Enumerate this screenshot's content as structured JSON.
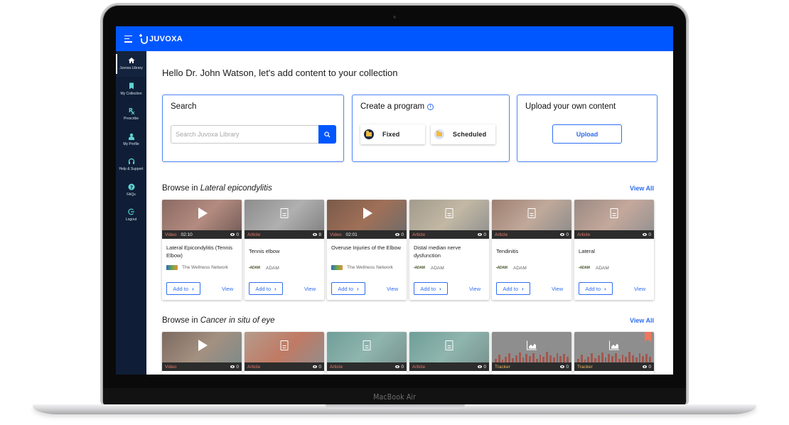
{
  "device": {
    "label": "MacBook Air"
  },
  "topbar": {
    "brand": "JUVOXA",
    "menu_icon": "hamburger-menu-icon",
    "primary_color": "#0057ff"
  },
  "sidebar": {
    "bg_color": "#0f1e36",
    "items": [
      {
        "label": "Juvoxa Library",
        "icon": "home-icon",
        "active": true
      },
      {
        "label": "My Collection",
        "icon": "bookmark-icon",
        "active": false
      },
      {
        "label": "Prescribe",
        "icon": "rx-icon",
        "active": false
      },
      {
        "label": "My Profile",
        "icon": "user-icon",
        "active": false
      },
      {
        "label": "Help & Support",
        "icon": "headset-icon",
        "active": false
      },
      {
        "label": "FAQs",
        "icon": "question-icon",
        "active": false
      },
      {
        "label": "Logout",
        "icon": "logout-icon",
        "active": false
      }
    ]
  },
  "main": {
    "greeting": "Hello Dr. John Watson, let's add content to your collection",
    "search": {
      "title": "Search",
      "placeholder": "Search Juvoxa Library",
      "value": ""
    },
    "program": {
      "title": "Create a program",
      "options": [
        {
          "label": "Fixed"
        },
        {
          "label": "Scheduled"
        }
      ]
    },
    "upload": {
      "title": "Upload your own content",
      "button": "Upload"
    },
    "sections": [
      {
        "prefix": "Browse in ",
        "topic": "Lateral epicondylitis",
        "view_all": "View All",
        "items": [
          {
            "type": "Video",
            "duration": "02:10",
            "views": "0",
            "title": "Lateral Epicondylitis (Tennis Elbow)",
            "provider": "The Wellness Network",
            "add": "Add to",
            "view": "View"
          },
          {
            "type": "Article",
            "duration": "",
            "views": "8",
            "title": "Tennis elbow",
            "provider": "ADAM",
            "add": "Add to",
            "view": "View"
          },
          {
            "type": "Video",
            "duration": "02:01",
            "views": "0",
            "title": "Overuse Injuries of the Elbow",
            "provider": "The Wellness Network",
            "add": "Add to",
            "view": "View"
          },
          {
            "type": "Article",
            "duration": "",
            "views": "0",
            "title": "Distal median nerve dysfunction",
            "provider": "ADAM",
            "add": "Add to",
            "view": "View"
          },
          {
            "type": "Article",
            "duration": "",
            "views": "0",
            "title": "Tendinitis",
            "provider": "ADAM",
            "add": "Add to",
            "view": "View"
          },
          {
            "type": "Article",
            "duration": "",
            "views": "0",
            "title": "Lateral",
            "provider": "ADAM",
            "add": "Add to",
            "view": "View"
          }
        ]
      },
      {
        "prefix": "Browse in ",
        "topic": "Cancer in situ of eye",
        "view_all": "View All",
        "items": [
          {
            "type": "Video",
            "views": "0"
          },
          {
            "type": "Article",
            "views": "0"
          },
          {
            "type": "Article",
            "views": "0"
          },
          {
            "type": "Article",
            "views": "0"
          },
          {
            "type": "Tracker",
            "views": "0"
          },
          {
            "type": "Tracker",
            "views": "0"
          }
        ]
      }
    ]
  }
}
